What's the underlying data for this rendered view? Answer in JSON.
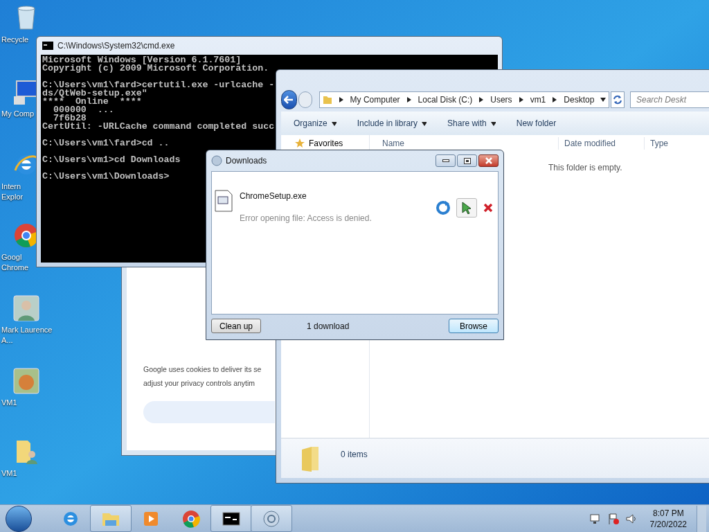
{
  "desktop_icons": [
    {
      "kind": "recycle",
      "label": "Recycle"
    },
    {
      "kind": "computer",
      "label": "My Comp"
    },
    {
      "kind": "ie",
      "label": "Intern Explor"
    },
    {
      "kind": "chrome",
      "label": "Googl Chrome"
    },
    {
      "kind": "user",
      "label": "Mark Laurence A..."
    },
    {
      "kind": "dog",
      "label": "VM1"
    },
    {
      "kind": "userfolder",
      "label": "VM1"
    }
  ],
  "browser_window": {
    "text_lines": [
      "Google uses cookies to deliver its se",
      "adjust your privacy controls anytim"
    ]
  },
  "cmd_window": {
    "title": "C:\\Windows\\System32\\cmd.exe",
    "blocks": [
      [
        "Microsoft Windows [Version 6.1.7601]",
        "Copyright (c) 2009 Microsoft Corporation."
      ],
      [
        "C:\\Users\\vm1\\fard>certutil.exe -urlcache -",
        "ds/QtWeb-setup.exe\"",
        "****  Online  ****",
        "  000000  ...",
        "  7f6b28",
        "CertUtil: -URLCache command completed succ"
      ],
      [
        "C:\\Users\\vm1\\fard>cd .."
      ],
      [
        "C:\\Users\\vm1>cd Downloads"
      ],
      [
        "C:\\Users\\vm1\\Downloads>"
      ]
    ]
  },
  "explorer_window": {
    "breadcrumb": [
      "My Computer",
      "Local Disk (C:)",
      "Users",
      "vm1",
      "Desktop"
    ],
    "search": {
      "placeholder": "Search Deskt"
    },
    "toolbar": [
      {
        "label": "Organize",
        "dropdown": true
      },
      {
        "label": "Include in library",
        "dropdown": true
      },
      {
        "label": "Share with",
        "dropdown": true
      },
      {
        "label": "New folder",
        "dropdown": false
      }
    ],
    "nav_pane": [
      "Favorites"
    ],
    "columns": [
      "Name",
      "Date modified",
      "Type"
    ],
    "empty_message": "This folder is empty.",
    "status": "0 items"
  },
  "downloads_window": {
    "title": "Downloads",
    "items": [
      {
        "name": "ChromeSetup.exe",
        "status": "Error opening file: Access is denied."
      }
    ],
    "footer": {
      "cleanup": "Clean up",
      "count": "1 download",
      "browse": "Browse"
    }
  },
  "taskbar": {
    "buttons": [
      {
        "kind": "ie",
        "running": false
      },
      {
        "kind": "explorer",
        "running": true
      },
      {
        "kind": "media",
        "running": false
      },
      {
        "kind": "chrome",
        "running": false
      },
      {
        "kind": "cmd",
        "running": true
      },
      {
        "kind": "qt",
        "running": true
      }
    ],
    "time": "8:07 PM",
    "date": "7/20/2022"
  }
}
